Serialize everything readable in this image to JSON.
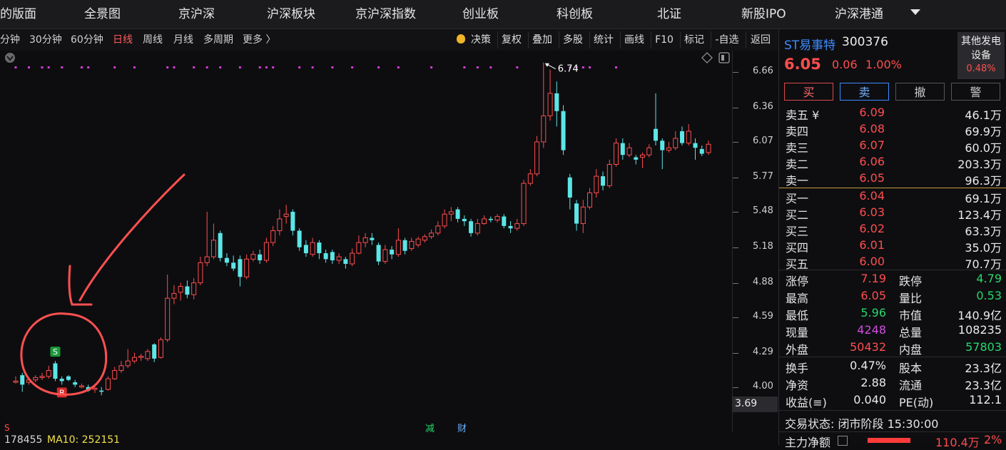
{
  "nav": {
    "items": [
      "的版面",
      "全景图",
      "京沪深",
      "沪深板块",
      "京沪深指数",
      "创业板",
      "科创板",
      "北证",
      "新股IPO",
      "沪深港通"
    ]
  },
  "periods": [
    "分钟",
    "30分钟",
    "60分钟",
    "日线",
    "周线",
    "月线",
    "多周期",
    "更多 〉"
  ],
  "active_period": "日线",
  "tools": [
    "决策",
    "复权",
    "叠加",
    "多股",
    "统计",
    "画线",
    "F10",
    "标记",
    "-自选",
    "返回"
  ],
  "chart_data": {
    "type": "candlestick",
    "ylim": [
      3.69,
      6.81
    ],
    "yticks": [
      6.66,
      6.36,
      6.07,
      5.77,
      5.48,
      5.18,
      4.88,
      4.59,
      4.29,
      4.0
    ],
    "yticks_text": [
      "6.66",
      "6.36",
      "6.07",
      "5.77",
      "5.48",
      "5.18",
      "4.88",
      "4.59",
      "4.29",
      "4.00"
    ],
    "current_price_label": "3.69",
    "max_annotation": "6.74",
    "signals": [
      {
        "label": "S",
        "color": "#1a9a3a",
        "index": 6
      },
      {
        "label": "B",
        "color": "#d32a2a",
        "index": 7
      }
    ],
    "candles": [
      {
        "o": 4.04,
        "c": 4.05,
        "h": 4.09,
        "l": 4.03
      },
      {
        "o": 4.1,
        "c": 4.02,
        "h": 4.12,
        "l": 3.96
      },
      {
        "o": 4.04,
        "c": 4.06,
        "h": 4.08,
        "l": 4.02
      },
      {
        "o": 4.06,
        "c": 4.08,
        "h": 4.1,
        "l": 4.04
      },
      {
        "o": 4.08,
        "c": 4.09,
        "h": 4.12,
        "l": 4.06
      },
      {
        "o": 4.09,
        "c": 4.14,
        "h": 4.18,
        "l": 4.07
      },
      {
        "o": 4.2,
        "c": 4.07,
        "h": 4.22,
        "l": 4.05
      },
      {
        "o": 4.07,
        "c": 4.05,
        "h": 4.09,
        "l": 4.02
      },
      {
        "o": 4.09,
        "c": 4.06,
        "h": 4.1,
        "l": 4.05
      },
      {
        "o": 4.04,
        "c": 4.02,
        "h": 4.06,
        "l": 4.0
      },
      {
        "o": 4.0,
        "c": 4.01,
        "h": 4.03,
        "l": 3.99
      },
      {
        "o": 4.0,
        "c": 3.97,
        "h": 4.02,
        "l": 3.96
      },
      {
        "o": 3.98,
        "c": 3.99,
        "h": 4.01,
        "l": 3.95
      },
      {
        "o": 3.97,
        "c": 3.96,
        "h": 4.0,
        "l": 3.93
      },
      {
        "o": 3.98,
        "c": 4.07,
        "h": 4.09,
        "l": 3.97
      },
      {
        "o": 4.07,
        "c": 4.14,
        "h": 4.17,
        "l": 4.06
      },
      {
        "o": 4.14,
        "c": 4.18,
        "h": 4.22,
        "l": 4.12
      },
      {
        "o": 4.18,
        "c": 4.22,
        "h": 4.32,
        "l": 4.16
      },
      {
        "o": 4.22,
        "c": 4.25,
        "h": 4.29,
        "l": 4.2
      },
      {
        "o": 4.25,
        "c": 4.26,
        "h": 4.28,
        "l": 4.22
      },
      {
        "o": 4.24,
        "c": 4.3,
        "h": 4.32,
        "l": 4.22
      },
      {
        "o": 4.36,
        "c": 4.24,
        "h": 4.37,
        "l": 4.21
      },
      {
        "o": 4.25,
        "c": 4.4,
        "h": 4.42,
        "l": 4.24
      },
      {
        "o": 4.4,
        "c": 4.75,
        "h": 4.95,
        "l": 4.38
      },
      {
        "o": 4.75,
        "c": 4.79,
        "h": 4.86,
        "l": 4.7
      },
      {
        "o": 4.8,
        "c": 4.85,
        "h": 4.88,
        "l": 4.73
      },
      {
        "o": 4.85,
        "c": 4.78,
        "h": 4.9,
        "l": 4.75
      },
      {
        "o": 4.78,
        "c": 4.88,
        "h": 4.92,
        "l": 4.74
      },
      {
        "o": 4.88,
        "c": 5.05,
        "h": 5.1,
        "l": 4.86
      },
      {
        "o": 5.05,
        "c": 5.1,
        "h": 5.48,
        "l": 5.02
      },
      {
        "o": 5.1,
        "c": 5.24,
        "h": 5.38,
        "l": 5.08
      },
      {
        "o": 5.3,
        "c": 5.09,
        "h": 5.32,
        "l": 5.06
      },
      {
        "o": 5.09,
        "c": 5.05,
        "h": 5.13,
        "l": 5.02
      },
      {
        "o": 5.05,
        "c": 5.0,
        "h": 5.11,
        "l": 4.98
      },
      {
        "o": 5.08,
        "c": 4.93,
        "h": 5.11,
        "l": 4.85
      },
      {
        "o": 4.93,
        "c": 5.08,
        "h": 5.12,
        "l": 4.91
      },
      {
        "o": 5.08,
        "c": 5.12,
        "h": 5.15,
        "l": 5.06
      },
      {
        "o": 5.12,
        "c": 5.07,
        "h": 5.16,
        "l": 5.04
      },
      {
        "o": 5.07,
        "c": 5.22,
        "h": 5.26,
        "l": 5.05
      },
      {
        "o": 5.22,
        "c": 5.32,
        "h": 5.36,
        "l": 5.19
      },
      {
        "o": 5.32,
        "c": 5.42,
        "h": 5.5,
        "l": 5.28
      },
      {
        "o": 5.44,
        "c": 5.46,
        "h": 5.54,
        "l": 5.38
      },
      {
        "o": 5.48,
        "c": 5.32,
        "h": 5.5,
        "l": 5.28
      },
      {
        "o": 5.32,
        "c": 5.18,
        "h": 5.34,
        "l": 5.15
      },
      {
        "o": 5.2,
        "c": 5.13,
        "h": 5.24,
        "l": 5.1
      },
      {
        "o": 5.12,
        "c": 5.22,
        "h": 5.26,
        "l": 5.1
      },
      {
        "o": 5.22,
        "c": 5.13,
        "h": 5.24,
        "l": 5.08
      },
      {
        "o": 5.13,
        "c": 5.08,
        "h": 5.16,
        "l": 5.05
      },
      {
        "o": 5.14,
        "c": 5.07,
        "h": 5.16,
        "l": 5.04
      },
      {
        "o": 5.07,
        "c": 5.1,
        "h": 5.13,
        "l": 5.04
      },
      {
        "o": 5.08,
        "c": 5.04,
        "h": 5.1,
        "l": 5.0
      },
      {
        "o": 5.04,
        "c": 5.13,
        "h": 5.17,
        "l": 5.02
      },
      {
        "o": 5.13,
        "c": 5.22,
        "h": 5.28,
        "l": 5.12
      },
      {
        "o": 5.22,
        "c": 5.26,
        "h": 5.3,
        "l": 5.18
      },
      {
        "o": 5.26,
        "c": 5.24,
        "h": 5.3,
        "l": 5.2
      },
      {
        "o": 5.2,
        "c": 5.06,
        "h": 5.22,
        "l": 5.03
      },
      {
        "o": 5.06,
        "c": 5.16,
        "h": 5.2,
        "l": 5.04
      },
      {
        "o": 5.16,
        "c": 5.12,
        "h": 5.19,
        "l": 5.08
      },
      {
        "o": 5.12,
        "c": 5.24,
        "h": 5.34,
        "l": 5.1
      },
      {
        "o": 5.24,
        "c": 5.15,
        "h": 5.26,
        "l": 5.12
      },
      {
        "o": 5.17,
        "c": 5.23,
        "h": 5.26,
        "l": 5.15
      },
      {
        "o": 5.2,
        "c": 5.25,
        "h": 5.27,
        "l": 5.18
      },
      {
        "o": 5.24,
        "c": 5.27,
        "h": 5.29,
        "l": 5.22
      },
      {
        "o": 5.27,
        "c": 5.3,
        "h": 5.33,
        "l": 5.25
      },
      {
        "o": 5.3,
        "c": 5.36,
        "h": 5.4,
        "l": 5.28
      },
      {
        "o": 5.36,
        "c": 5.46,
        "h": 5.5,
        "l": 5.34
      },
      {
        "o": 5.46,
        "c": 5.48,
        "h": 5.52,
        "l": 5.4
      },
      {
        "o": 5.5,
        "c": 5.42,
        "h": 5.52,
        "l": 5.39
      },
      {
        "o": 5.42,
        "c": 5.4,
        "h": 5.45,
        "l": 5.36
      },
      {
        "o": 5.4,
        "c": 5.3,
        "h": 5.42,
        "l": 5.27
      },
      {
        "o": 5.3,
        "c": 5.38,
        "h": 5.42,
        "l": 5.28
      },
      {
        "o": 5.38,
        "c": 5.42,
        "h": 5.45,
        "l": 5.37
      },
      {
        "o": 5.42,
        "c": 5.41,
        "h": 5.44,
        "l": 5.39
      },
      {
        "o": 5.41,
        "c": 5.44,
        "h": 5.46,
        "l": 5.39
      },
      {
        "o": 5.44,
        "c": 5.36,
        "h": 5.46,
        "l": 5.34
      },
      {
        "o": 5.36,
        "c": 5.34,
        "h": 5.4,
        "l": 5.3
      },
      {
        "o": 5.34,
        "c": 5.38,
        "h": 5.42,
        "l": 5.32
      },
      {
        "o": 5.38,
        "c": 5.72,
        "h": 5.75,
        "l": 5.36
      },
      {
        "o": 5.72,
        "c": 5.8,
        "h": 5.84,
        "l": 5.7
      },
      {
        "o": 5.8,
        "c": 6.07,
        "h": 6.12,
        "l": 5.78
      },
      {
        "o": 6.07,
        "c": 6.29,
        "h": 6.74,
        "l": 6.02
      },
      {
        "o": 6.29,
        "c": 6.48,
        "h": 6.68,
        "l": 6.25
      },
      {
        "o": 6.48,
        "c": 6.33,
        "h": 6.58,
        "l": 6.2
      },
      {
        "o": 6.33,
        "c": 6.0,
        "h": 6.38,
        "l": 5.96
      },
      {
        "o": 5.77,
        "c": 5.6,
        "h": 5.8,
        "l": 5.5
      },
      {
        "o": 5.55,
        "c": 5.38,
        "h": 5.58,
        "l": 5.32
      },
      {
        "o": 5.38,
        "c": 5.52,
        "h": 5.58,
        "l": 5.3
      },
      {
        "o": 5.52,
        "c": 5.64,
        "h": 5.68,
        "l": 5.5
      },
      {
        "o": 5.64,
        "c": 5.78,
        "h": 5.84,
        "l": 5.6
      },
      {
        "o": 5.78,
        "c": 5.7,
        "h": 5.82,
        "l": 5.66
      },
      {
        "o": 5.7,
        "c": 5.88,
        "h": 5.92,
        "l": 5.68
      },
      {
        "o": 5.88,
        "c": 6.06,
        "h": 6.1,
        "l": 5.86
      },
      {
        "o": 6.06,
        "c": 5.96,
        "h": 6.1,
        "l": 5.92
      },
      {
        "o": 5.96,
        "c": 6.02,
        "h": 6.06,
        "l": 5.94
      },
      {
        "o": 5.94,
        "c": 5.92,
        "h": 5.96,
        "l": 5.88
      },
      {
        "o": 5.94,
        "c": 5.96,
        "h": 5.98,
        "l": 5.85
      },
      {
        "o": 5.96,
        "c": 6.02,
        "h": 6.05,
        "l": 5.94
      },
      {
        "o": 6.18,
        "c": 6.08,
        "h": 6.48,
        "l": 6.04
      },
      {
        "o": 6.08,
        "c": 6.0,
        "h": 6.1,
        "l": 5.84
      },
      {
        "o": 6.0,
        "c": 6.02,
        "h": 6.07,
        "l": 5.98
      },
      {
        "o": 6.02,
        "c": 6.1,
        "h": 6.16,
        "l": 6.0
      },
      {
        "o": 6.16,
        "c": 6.06,
        "h": 6.2,
        "l": 6.04
      },
      {
        "o": 6.06,
        "c": 6.16,
        "h": 6.22,
        "l": 6.04
      },
      {
        "o": 6.06,
        "c": 6.02,
        "h": 6.1,
        "l": 5.92
      },
      {
        "o": 6.01,
        "c": 5.97,
        "h": 6.04,
        "l": 5.95
      },
      {
        "o": 5.98,
        "c": 6.05,
        "h": 6.08,
        "l": 5.96
      }
    ],
    "dots": [
      0,
      2,
      4,
      5,
      7,
      10,
      11,
      15,
      18,
      23,
      24,
      27,
      29,
      31,
      34,
      37,
      38,
      39,
      43,
      45,
      48,
      51,
      55,
      58,
      63,
      68,
      70,
      72,
      76,
      84,
      85,
      86,
      87,
      91
    ]
  },
  "bottom": {
    "indicator_a": "178455",
    "indicator_b": "MA10: 252151",
    "marker_s": "S",
    "tag_jian": "减",
    "tag_cai": "财"
  },
  "stock": {
    "name": "ST易事特",
    "code": "300376",
    "industry_line1": "其他发电",
    "industry_line2": "设备",
    "industry_change": "0.48%",
    "price": "6.05",
    "change": "0.06",
    "change_pct": "1.00%"
  },
  "trade_buttons": {
    "buy": "买",
    "sell": "卖",
    "cancel": "撤",
    "alert": "警"
  },
  "asks": [
    {
      "label": "卖五 ¥",
      "price": "6.09",
      "volume": "46.1万"
    },
    {
      "label": "卖四",
      "price": "6.08",
      "volume": "69.9万"
    },
    {
      "label": "卖三",
      "price": "6.07",
      "volume": "60.0万"
    },
    {
      "label": "卖二",
      "price": "6.06",
      "volume": "203.3万"
    },
    {
      "label": "卖一",
      "price": "6.05",
      "volume": "96.3万"
    }
  ],
  "bids": [
    {
      "label": "买一",
      "price": "6.04",
      "volume": "69.1万"
    },
    {
      "label": "买二",
      "price": "6.03",
      "volume": "123.4万"
    },
    {
      "label": "买三",
      "price": "6.02",
      "volume": "63.3万"
    },
    {
      "label": "买四",
      "price": "6.01",
      "volume": "35.0万"
    },
    {
      "label": "买五",
      "price": "6.00",
      "volume": "70.7万"
    }
  ],
  "stats1": [
    {
      "l1": "涨停",
      "v1": "7.19",
      "c1": "red",
      "l2": "跌停",
      "v2": "4.79",
      "c2": "green"
    },
    {
      "l1": "最高",
      "v1": "6.05",
      "c1": "red",
      "l2": "量比",
      "v2": "0.53",
      "c2": "green"
    },
    {
      "l1": "最低",
      "v1": "5.96",
      "c1": "green",
      "l2": "市值",
      "v2": "140.9亿",
      "c2": "white"
    },
    {
      "l1": "现量",
      "v1": "4248",
      "c1": "purple",
      "l2": "总量",
      "v2": "108235",
      "c2": "white"
    },
    {
      "l1": "外盘",
      "v1": "50432",
      "c1": "red",
      "l2": "内盘",
      "v2": "57803",
      "c2": "green"
    }
  ],
  "stats2": [
    {
      "l1": "换手",
      "v1": "0.47%",
      "l2": "股本",
      "v2": "23.3亿"
    },
    {
      "l1": "净资",
      "v1": "2.88",
      "l2": "流通",
      "v2": "23.3亿"
    },
    {
      "l1": "收益(≡)",
      "v1": "0.040",
      "l2": "PE(动)",
      "v2": "112.1"
    }
  ],
  "trade_status": "交易状态: 闭市阶段 15:30:00",
  "main_flow": {
    "label": "主力净额",
    "value": "110.4万",
    "pct": "2%"
  },
  "colors": {
    "up": "#ff4d4d",
    "down": "#5ce6e6",
    "accent": "#3d8bfd",
    "dot": "#d63ad6",
    "annotation": "#ff5050"
  }
}
